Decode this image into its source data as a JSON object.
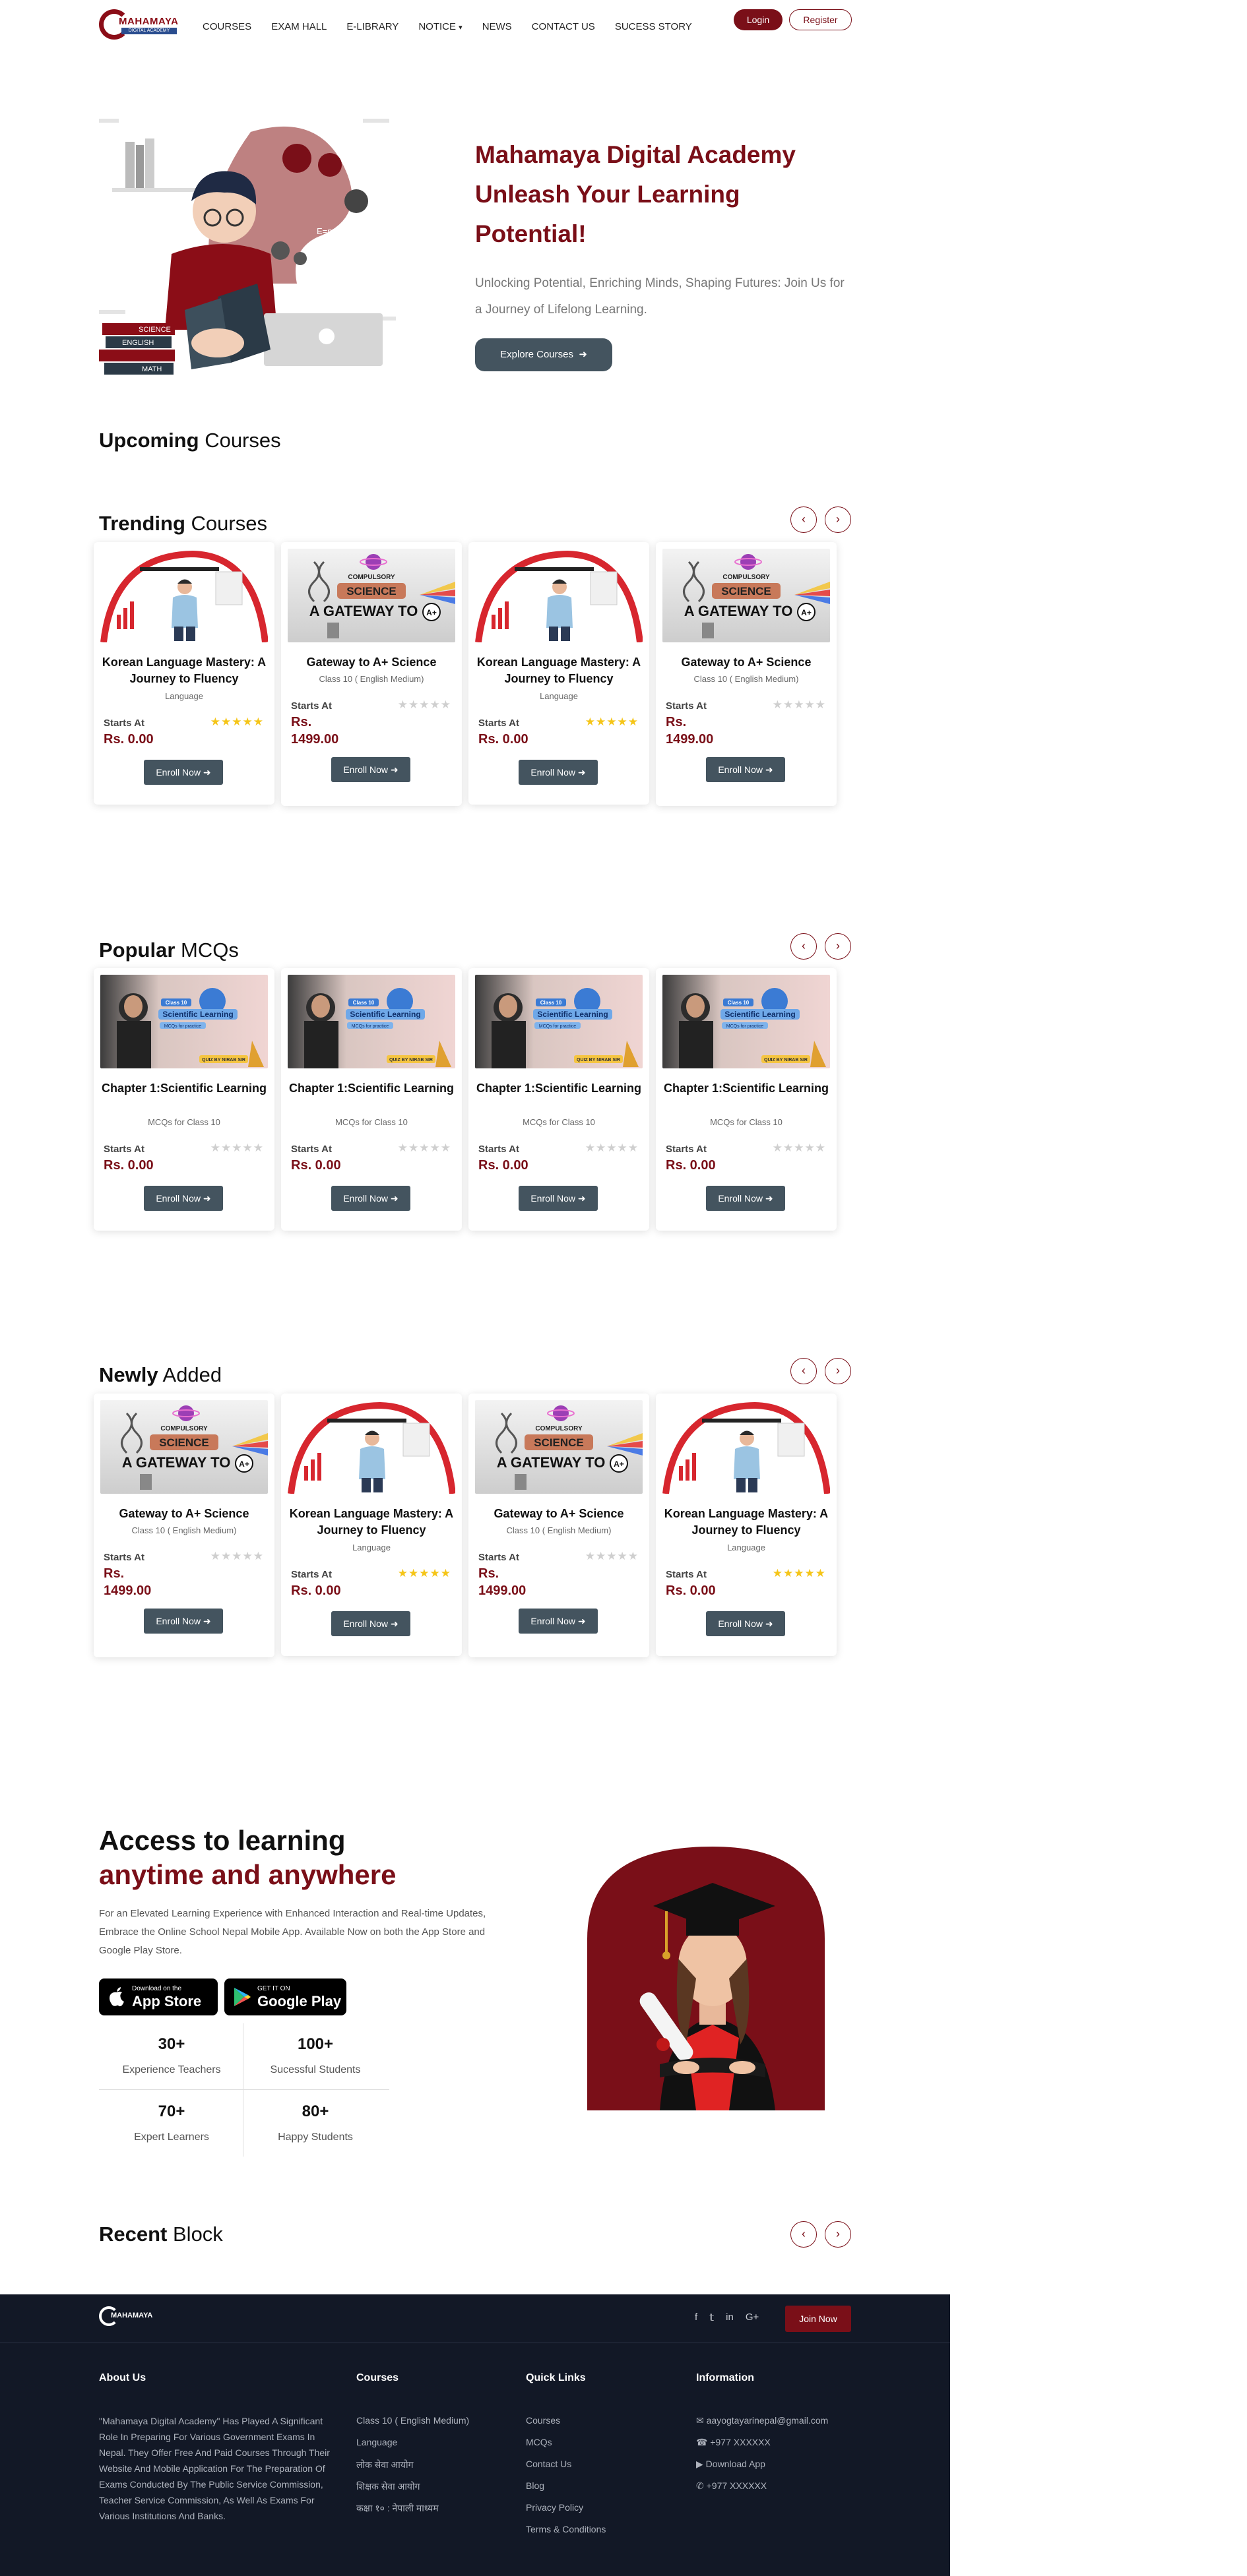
{
  "header": {
    "logo_name": "MAHAMAYA",
    "logo_sub": "DIGITAL ACADEMY",
    "nav": [
      "COURSES",
      "EXAM HALL",
      "E-LIBRARY",
      "NOTICE",
      "NEWS",
      "CONTACT US",
      "SUCESS STORY"
    ],
    "login": "Login",
    "register": "Register"
  },
  "hero": {
    "title": "Mahamaya Digital Academy Unleash Your Learning Potential!",
    "subtitle": "Unlocking Potential, Enriching Minds, Shaping Futures: Join Us for a Journey of Lifelong Learning.",
    "button": "Explore Courses",
    "illus_labels": [
      "SCIENCE",
      "ENGLISH",
      "MATH",
      "E=mc²"
    ]
  },
  "sections": {
    "upcoming": {
      "bold": "Upcoming",
      "rest": "Courses"
    },
    "trending": {
      "bold": "Trending",
      "rest": "Courses"
    },
    "popular": {
      "bold": "Popular",
      "rest": "MCQs"
    },
    "newly": {
      "bold": "Newly",
      "rest": "Added"
    },
    "recent": {
      "bold": "Recent",
      "rest": "Block"
    }
  },
  "common": {
    "starts_at": "Starts At",
    "enroll": "Enroll Now"
  },
  "trending_cards": [
    {
      "title": "Korean Language Mastery: A Journey to Fluency",
      "sub": "Language",
      "price": "Rs. 0.00",
      "rating": "gold",
      "thumb": "korean"
    },
    {
      "title": "Gateway to A+ Science",
      "sub": "Class 10 ( English Medium)",
      "price": "Rs. 1499.00",
      "rating": "grey",
      "thumb": "science"
    },
    {
      "title": "Korean Language Mastery: A Journey to Fluency",
      "sub": "Language",
      "price": "Rs. 0.00",
      "rating": "gold",
      "thumb": "korean"
    },
    {
      "title": "Gateway to A+ Science",
      "sub": "Class 10 ( English Medium)",
      "price": "Rs. 1499.00",
      "rating": "grey",
      "thumb": "science"
    }
  ],
  "mcq_cards": [
    {
      "title": "Chapter 1:Scientific Learning",
      "sub": "MCQs for Class 10",
      "price": "Rs. 0.00",
      "rating": "grey",
      "thumb": "mcq"
    },
    {
      "title": "Chapter 1:Scientific Learning",
      "sub": "MCQs for Class 10",
      "price": "Rs. 0.00",
      "rating": "grey",
      "thumb": "mcq"
    },
    {
      "title": "Chapter 1:Scientific Learning",
      "sub": "MCQs for Class 10",
      "price": "Rs. 0.00",
      "rating": "grey",
      "thumb": "mcq"
    },
    {
      "title": "Chapter 1:Scientific Learning",
      "sub": "MCQs for Class 10",
      "price": "Rs. 0.00",
      "rating": "grey",
      "thumb": "mcq"
    }
  ],
  "newly_cards": [
    {
      "title": "Gateway to A+ Science",
      "sub": "Class 10 ( English Medium)",
      "price": "Rs. 1499.00",
      "rating": "grey",
      "thumb": "science"
    },
    {
      "title": "Korean Language Mastery: A Journey to Fluency",
      "sub": "Language",
      "price": "Rs. 0.00",
      "rating": "gold",
      "thumb": "korean"
    },
    {
      "title": "Gateway to A+ Science",
      "sub": "Class 10 ( English Medium)",
      "price": "Rs. 1499.00",
      "rating": "grey",
      "thumb": "science"
    },
    {
      "title": "Korean Language Mastery: A Journey to Fluency",
      "sub": "Language",
      "price": "Rs. 0.00",
      "rating": "gold",
      "thumb": "korean"
    }
  ],
  "thumb_text": {
    "science_top": "COMPULSORY",
    "science_mid": "SCIENCE",
    "science_bottom": "A GATEWAY TO",
    "science_badge": "A+",
    "mcq_top": "Class 10",
    "mcq_mid": "Scientific Learning",
    "mcq_small": "MCQs for practice",
    "mcq_tag": "QUIZ BY NIRAB SIR"
  },
  "app": {
    "title1": "Access to learning",
    "title2": "anytime and anywhere",
    "desc": "For an Elevated Learning Experience with Enhanced Interaction and Real-time Updates, Embrace the Online School Nepal Mobile App. Available Now on both the App Store and Google Play Store.",
    "appstore_small": "Download on the",
    "appstore_big": "App Store",
    "play_small": "GET IT ON",
    "play_big": "Google Play",
    "stats": [
      {
        "num": "30+",
        "label": "Experience Teachers"
      },
      {
        "num": "100+",
        "label": "Sucessful Students"
      },
      {
        "num": "70+",
        "label": "Expert Learners"
      },
      {
        "num": "80+",
        "label": "Happy Students"
      }
    ]
  },
  "footer": {
    "logo": "MAHAMAYA",
    "join": "Join Now",
    "about_head": "About Us",
    "about_text": "\"Mahamaya Digital Academy\" Has Played A Significant Role In Preparing For Various Government Exams In Nepal. They Offer Free And Paid Courses Through Their Website And Mobile Application For The Preparation Of Exams Conducted By The Public Service Commission, Teacher Service Commission, As Well As Exams For Various Institutions And Banks.",
    "courses_head": "Courses",
    "courses": [
      "Class 10 ( English Medium)",
      "Language",
      "लोक सेवा आयोग",
      "शिक्षक सेवा आयोग",
      "कक्षा १० : नेपाली माध्यम"
    ],
    "links_head": "Quick Links",
    "links": [
      "Courses",
      "MCQs",
      "Contact Us",
      "Blog",
      "Privacy Policy",
      "Terms & Conditions"
    ],
    "info_head": "Information",
    "info": [
      "aayogtayarinepal@gmail.com",
      "+977 XXXXXX",
      "Download App",
      "+977 XXXXXX"
    ]
  }
}
